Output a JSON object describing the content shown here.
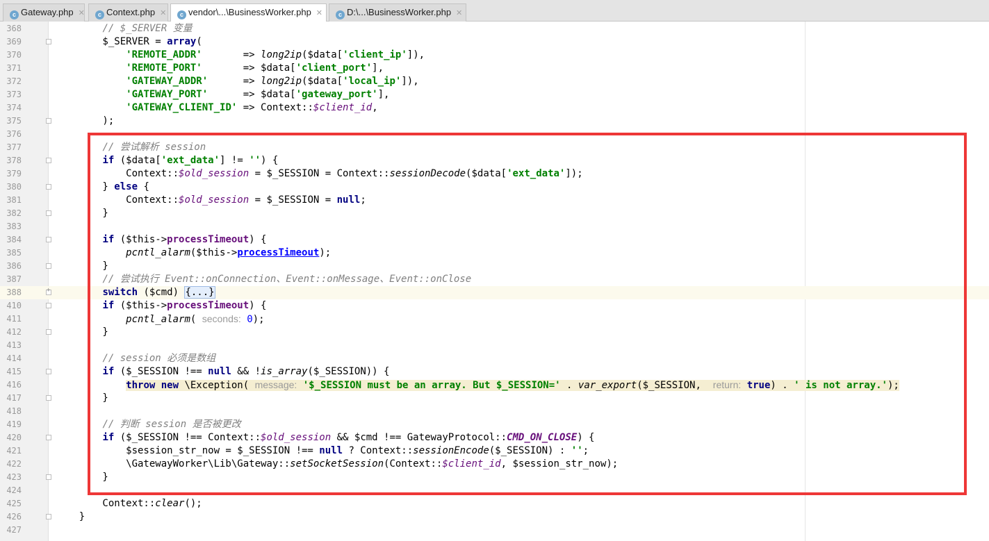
{
  "tabs": [
    {
      "label": "Gateway.php",
      "icon": "php-class-icon",
      "active": false
    },
    {
      "label": "Context.php",
      "icon": "php-class-icon",
      "active": false
    },
    {
      "label": "vendor\\...\\BusinessWorker.php",
      "icon": "php-class-icon",
      "active": true
    },
    {
      "label": "D:\\...\\BusinessWorker.php",
      "icon": "php-class-icon",
      "active": false
    }
  ],
  "editor": {
    "lines": [
      {
        "n": "368",
        "fold": "none",
        "tokens": [
          [
            "",
            "        "
          ],
          [
            "cm",
            "// $_SERVER 变量"
          ]
        ]
      },
      {
        "n": "369",
        "fold": "open",
        "tokens": [
          [
            "",
            "        $_SERVER = "
          ],
          [
            "kw",
            "array"
          ],
          [
            "",
            "("
          ]
        ]
      },
      {
        "n": "370",
        "fold": "none",
        "tokens": [
          [
            "",
            "            "
          ],
          [
            "str",
            "'REMOTE_ADDR'"
          ],
          [
            "",
            "       => "
          ],
          [
            "fn",
            "long2ip"
          ],
          [
            "",
            "($data["
          ],
          [
            "str",
            "'client_ip'"
          ],
          [
            "",
            "]),"
          ]
        ]
      },
      {
        "n": "371",
        "fold": "none",
        "tokens": [
          [
            "",
            "            "
          ],
          [
            "str",
            "'REMOTE_PORT'"
          ],
          [
            "",
            "       => $data["
          ],
          [
            "str",
            "'client_port'"
          ],
          [
            "",
            "],"
          ]
        ]
      },
      {
        "n": "372",
        "fold": "none",
        "tokens": [
          [
            "",
            "            "
          ],
          [
            "str",
            "'GATEWAY_ADDR'"
          ],
          [
            "",
            "      => "
          ],
          [
            "fn",
            "long2ip"
          ],
          [
            "",
            "($data["
          ],
          [
            "str",
            "'local_ip'"
          ],
          [
            "",
            "]),"
          ]
        ]
      },
      {
        "n": "373",
        "fold": "none",
        "tokens": [
          [
            "",
            "            "
          ],
          [
            "str",
            "'GATEWAY_PORT'"
          ],
          [
            "",
            "      => $data["
          ],
          [
            "str",
            "'gateway_port'"
          ],
          [
            "",
            "],"
          ]
        ]
      },
      {
        "n": "374",
        "fold": "none",
        "tokens": [
          [
            "",
            "            "
          ],
          [
            "str",
            "'GATEWAY_CLIENT_ID'"
          ],
          [
            "",
            " => Context::"
          ],
          [
            "st",
            "$client_id"
          ],
          [
            "",
            ","
          ]
        ]
      },
      {
        "n": "375",
        "fold": "open",
        "tokens": [
          [
            "",
            "        );"
          ]
        ]
      },
      {
        "n": "376",
        "fold": "none",
        "tokens": []
      },
      {
        "n": "377",
        "fold": "none",
        "tokens": [
          [
            "",
            "        "
          ],
          [
            "cm",
            "// 尝试解析 session"
          ]
        ]
      },
      {
        "n": "378",
        "fold": "open",
        "tokens": [
          [
            "",
            "        "
          ],
          [
            "kw",
            "if"
          ],
          [
            "",
            " ($data["
          ],
          [
            "str",
            "'ext_data'"
          ],
          [
            "",
            "] != "
          ],
          [
            "str",
            "''"
          ],
          [
            "",
            ") {"
          ]
        ]
      },
      {
        "n": "379",
        "fold": "none",
        "tokens": [
          [
            "",
            "            Context::"
          ],
          [
            "st",
            "$old_session"
          ],
          [
            "",
            " = $_SESSION = Context::"
          ],
          [
            "fn",
            "sessionDecode"
          ],
          [
            "",
            "($data["
          ],
          [
            "str",
            "'ext_data'"
          ],
          [
            "",
            "]);"
          ]
        ]
      },
      {
        "n": "380",
        "fold": "open",
        "tokens": [
          [
            "",
            "        } "
          ],
          [
            "kw",
            "else"
          ],
          [
            "",
            " {"
          ]
        ]
      },
      {
        "n": "381",
        "fold": "none",
        "tokens": [
          [
            "",
            "            Context::"
          ],
          [
            "st",
            "$old_session"
          ],
          [
            "",
            " = $_SESSION = "
          ],
          [
            "kw",
            "null"
          ],
          [
            "",
            ";"
          ]
        ]
      },
      {
        "n": "382",
        "fold": "open",
        "tokens": [
          [
            "",
            "        }"
          ]
        ]
      },
      {
        "n": "383",
        "fold": "none",
        "tokens": []
      },
      {
        "n": "384",
        "fold": "open",
        "tokens": [
          [
            "",
            "        "
          ],
          [
            "kw",
            "if"
          ],
          [
            "",
            " ($this->"
          ],
          [
            "prop",
            "processTimeout"
          ],
          [
            "",
            ") {"
          ]
        ]
      },
      {
        "n": "385",
        "fold": "none",
        "tokens": [
          [
            "",
            "            "
          ],
          [
            "fn",
            "pcntl_alarm"
          ],
          [
            "",
            "($this->"
          ],
          [
            "link",
            "processTimeout"
          ],
          [
            "",
            ");"
          ]
        ]
      },
      {
        "n": "386",
        "fold": "open",
        "tokens": [
          [
            "",
            "        }"
          ]
        ]
      },
      {
        "n": "387",
        "fold": "none",
        "tokens": [
          [
            "",
            "        "
          ],
          [
            "cm",
            "// 尝试执行 Event::onConnection、Event::onMessage、Event::onClose"
          ]
        ]
      },
      {
        "n": "388",
        "fold": "plus",
        "current": true,
        "tokens": [
          [
            "",
            "        "
          ],
          [
            "kw",
            "switch"
          ],
          [
            "",
            " ($cmd) "
          ],
          [
            "foldbox",
            "{...}"
          ]
        ]
      },
      {
        "n": "410",
        "fold": "open",
        "tokens": [
          [
            "",
            "        "
          ],
          [
            "kw",
            "if"
          ],
          [
            "",
            " ($this->"
          ],
          [
            "prop",
            "processTimeout"
          ],
          [
            "",
            ") {"
          ]
        ]
      },
      {
        "n": "411",
        "fold": "none",
        "tokens": [
          [
            "",
            "            "
          ],
          [
            "fn",
            "pcntl_alarm"
          ],
          [
            "",
            "( "
          ],
          [
            "hint",
            "seconds:"
          ],
          [
            "",
            " "
          ],
          [
            "num",
            "0"
          ],
          [
            "",
            ");"
          ]
        ]
      },
      {
        "n": "412",
        "fold": "open",
        "tokens": [
          [
            "",
            "        }"
          ]
        ]
      },
      {
        "n": "413",
        "fold": "none",
        "tokens": []
      },
      {
        "n": "414",
        "fold": "none",
        "tokens": [
          [
            "",
            "        "
          ],
          [
            "cm",
            "// session 必须是数组"
          ]
        ]
      },
      {
        "n": "415",
        "fold": "open",
        "tokens": [
          [
            "",
            "        "
          ],
          [
            "kw",
            "if"
          ],
          [
            "",
            " ($_SESSION !== "
          ],
          [
            "kw",
            "null"
          ],
          [
            "",
            " && !"
          ],
          [
            "fn",
            "is_array"
          ],
          [
            "",
            "($_SESSION)) {"
          ]
        ]
      },
      {
        "n": "416",
        "fold": "none",
        "highlight": true,
        "tokens": [
          [
            "",
            "            "
          ],
          [
            "kw",
            "throw new"
          ],
          [
            "",
            " \\Exception( "
          ],
          [
            "hint",
            "message:"
          ],
          [
            "",
            " "
          ],
          [
            "str",
            "'$_SESSION must be an array. But $_SESSION='"
          ],
          [
            "",
            " . "
          ],
          [
            "fn",
            "var_export"
          ],
          [
            "",
            "($_SESSION,  "
          ],
          [
            "hint",
            "return:"
          ],
          [
            "",
            " "
          ],
          [
            "kw",
            "true"
          ],
          [
            "",
            ") . "
          ],
          [
            "str",
            "' is not array.'"
          ],
          [
            "",
            ");"
          ]
        ]
      },
      {
        "n": "417",
        "fold": "open",
        "tokens": [
          [
            "",
            "        }"
          ]
        ]
      },
      {
        "n": "418",
        "fold": "none",
        "tokens": []
      },
      {
        "n": "419",
        "fold": "none",
        "tokens": [
          [
            "",
            "        "
          ],
          [
            "cm",
            "// 判断 session 是否被更改"
          ]
        ]
      },
      {
        "n": "420",
        "fold": "open",
        "tokens": [
          [
            "",
            "        "
          ],
          [
            "kw",
            "if"
          ],
          [
            "",
            " ($_SESSION !== Context::"
          ],
          [
            "st",
            "$old_session"
          ],
          [
            "",
            " && $cmd !== GatewayProtocol::"
          ],
          [
            "cst",
            "CMD_ON_CLOSE"
          ],
          [
            "",
            ") {"
          ]
        ]
      },
      {
        "n": "421",
        "fold": "none",
        "tokens": [
          [
            "",
            "            $session_str_now = $_SESSION !== "
          ],
          [
            "kw",
            "null"
          ],
          [
            "",
            " ? Context::"
          ],
          [
            "fn",
            "sessionEncode"
          ],
          [
            "",
            "($_SESSION) : "
          ],
          [
            "str",
            "''"
          ],
          [
            "",
            ";"
          ]
        ]
      },
      {
        "n": "422",
        "fold": "none",
        "tokens": [
          [
            "",
            "            \\GatewayWorker\\Lib\\Gateway::"
          ],
          [
            "fn",
            "setSocketSession"
          ],
          [
            "",
            "(Context::"
          ],
          [
            "st",
            "$client_id"
          ],
          [
            "",
            ", $session_str_now);"
          ]
        ]
      },
      {
        "n": "423",
        "fold": "open",
        "tokens": [
          [
            "",
            "        }"
          ]
        ]
      },
      {
        "n": "424",
        "fold": "none",
        "tokens": []
      },
      {
        "n": "425",
        "fold": "none",
        "tokens": [
          [
            "",
            "        Context::"
          ],
          [
            "fn",
            "clear"
          ],
          [
            "",
            "();"
          ]
        ]
      },
      {
        "n": "426",
        "fold": "open",
        "tokens": [
          [
            "",
            "    }"
          ]
        ]
      },
      {
        "n": "427",
        "fold": "none",
        "tokens": []
      }
    ]
  },
  "annotation": {
    "color": "#ee3737",
    "label": "red-highlight-box"
  }
}
